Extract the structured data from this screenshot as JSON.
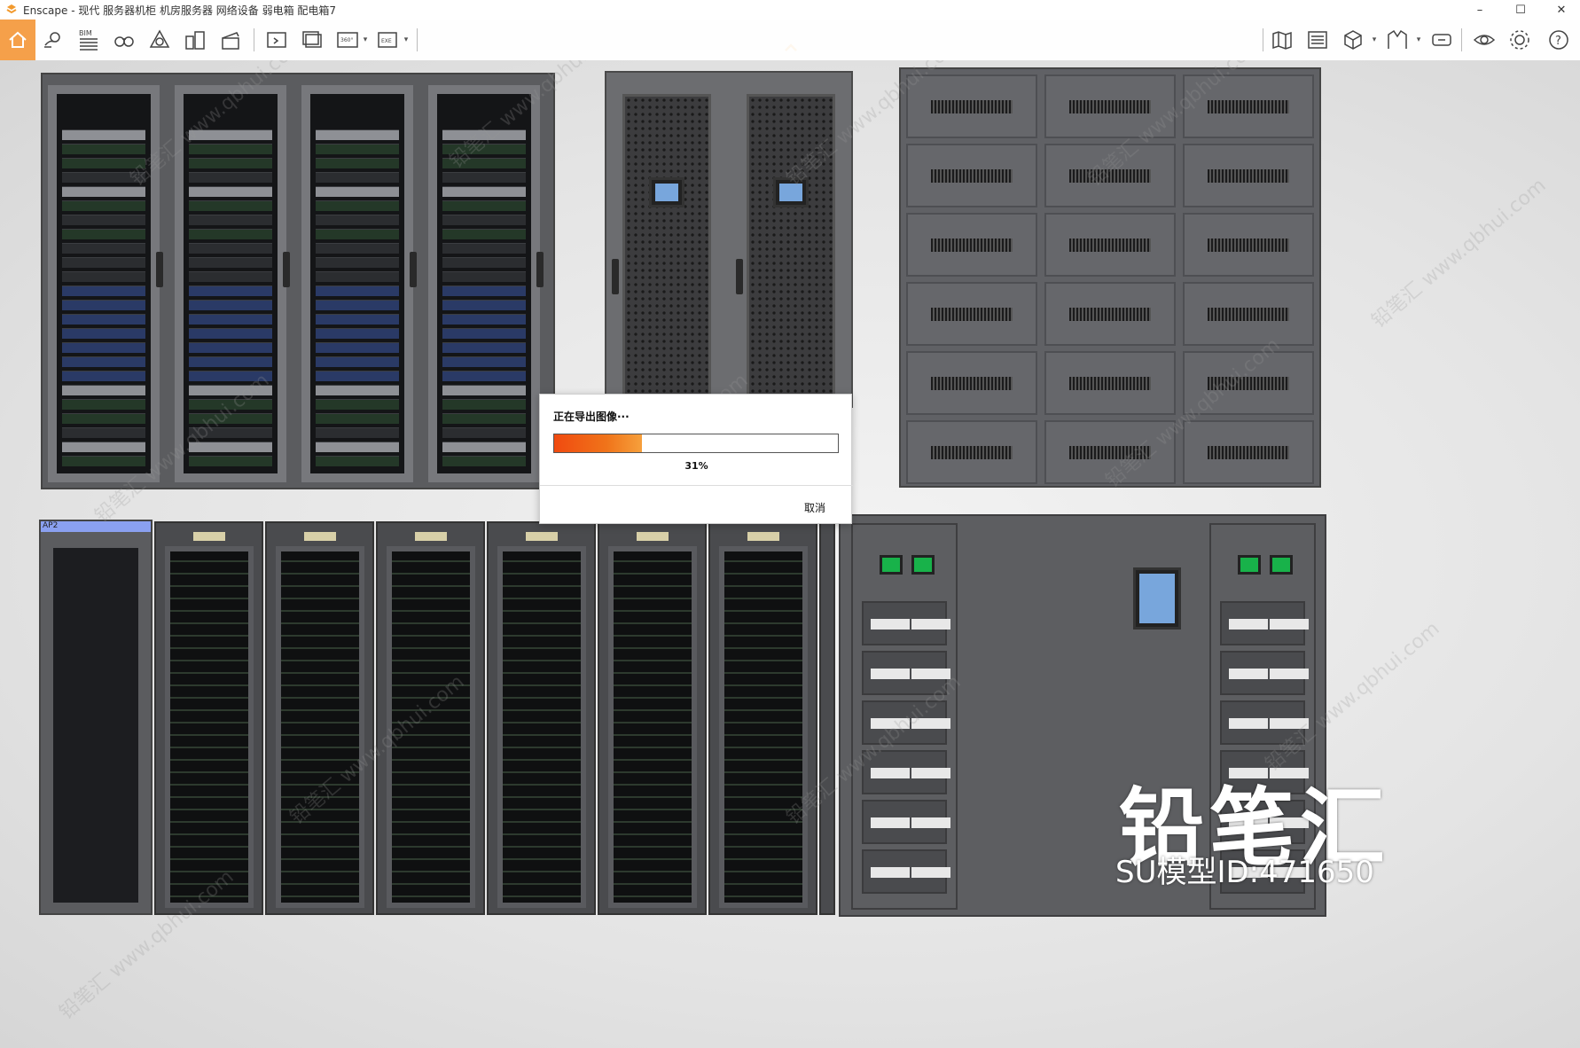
{
  "window": {
    "app_name": "Enscape",
    "title": "Enscape - 现代 服务器机柜 机房服务器 网络设备 弱电箱 配电箱7",
    "controls": {
      "minimize": "–",
      "maximize": "☐",
      "close": "✕"
    }
  },
  "toolbar": {
    "bim_label": "BIM",
    "items": [
      {
        "id": "home",
        "icon": "home-icon"
      },
      {
        "id": "pin",
        "icon": "map-pin-icon"
      },
      {
        "id": "bim",
        "icon": "bim-list-icon"
      },
      {
        "id": "binoculars",
        "icon": "binoculars-icon"
      },
      {
        "id": "sync",
        "icon": "sync-icon"
      },
      {
        "id": "buildings",
        "icon": "buildings-icon"
      },
      {
        "id": "clapper",
        "icon": "clapperboard-icon"
      },
      {
        "id": "screenshot",
        "icon": "screenshot-icon"
      },
      {
        "id": "batch",
        "icon": "batch-render-icon"
      },
      {
        "id": "pano",
        "icon": "panorama-360-icon",
        "text": "360°"
      },
      {
        "id": "exe",
        "icon": "export-exe-icon",
        "text": "EXE"
      },
      {
        "id": "map",
        "icon": "map-icon"
      },
      {
        "id": "library",
        "icon": "asset-library-icon"
      },
      {
        "id": "cube",
        "icon": "cube-icon"
      },
      {
        "id": "material",
        "icon": "material-icon"
      },
      {
        "id": "vr",
        "icon": "vr-headset-icon"
      },
      {
        "id": "visual",
        "icon": "visual-settings-icon"
      },
      {
        "id": "settings",
        "icon": "gear-icon"
      },
      {
        "id": "help",
        "icon": "help-icon"
      }
    ]
  },
  "dialog": {
    "title": "正在导出图像···",
    "progress": 0.31,
    "progress_text": "31%",
    "cancel_label": "取消"
  },
  "scene": {
    "panel_label": "AP2",
    "watermark_text": "铅笔汇 www.qbhui.com",
    "brand_name": "铅笔汇",
    "brand_id": "SU模型ID:471650"
  },
  "colors": {
    "accent": "#f5a04a",
    "progress_fill": "#f04a10",
    "screen_blue": "#78a6dc",
    "indicator_green": "#18b24a"
  }
}
